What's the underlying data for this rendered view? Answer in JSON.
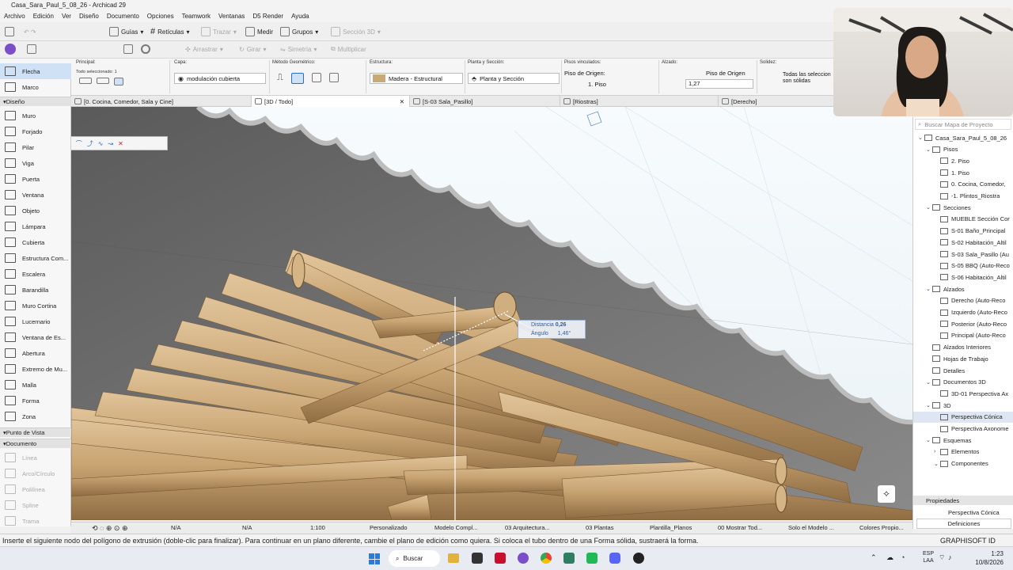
{
  "window": {
    "title": "Casa_Sara_Paul_5_08_26 - Archicad 29"
  },
  "menu": [
    "Archivo",
    "Edición",
    "Ver",
    "Diseño",
    "Documento",
    "Opciones",
    "Teamwork",
    "Ventanas",
    "D5 Render",
    "Ayuda"
  ],
  "toolbar1": {
    "guias": "Guías",
    "reticulas": "Retículas",
    "trazar": "Trazar",
    "medir": "Medir",
    "grupos": "Grupos",
    "seccion3d": "Sección 3D"
  },
  "toolbar2": {
    "arrastrar": "Arrastrar",
    "girar": "Girar",
    "simetria": "Simetría",
    "multiplicar": "Multiplicar"
  },
  "infobox": {
    "principal_label": "Principal:",
    "todo_sel": "Todo seleccionado: 1",
    "capa_label": "Capa:",
    "capa_value": "modulación cubierta",
    "metodo_label": "Método Geométrico:",
    "estructura_label": "Estructura:",
    "estructura_value": "Madera - Estructural",
    "planta_label": "Planta y Sección:",
    "planta_value": "Planta y Sección",
    "pisos_label": "Pisos vinculados:",
    "piso_origen_label": "Piso de Origen:",
    "piso_origen_value": "1. Piso",
    "alzado_label": "Alzado:",
    "alzado_ref": "Piso de Origen",
    "alzado_value": "1,27",
    "solidez_label": "Solidez:",
    "solidez_value": "Todas las seleccion son sólidas"
  },
  "toolbox": {
    "tools": [
      "Flecha",
      "Marco"
    ],
    "diseno": "Diseño",
    "design_tools": [
      "Muro",
      "Forjado",
      "Pilar",
      "Viga",
      "Puerta",
      "Ventana",
      "Objeto",
      "Lámpara",
      "Cubierta",
      "Estructura Com...",
      "Escalera",
      "Barandilla",
      "Muro Cortina",
      "Lucernario",
      "Ventana de Es...",
      "Abertura",
      "Extremo de Mu...",
      "Malla",
      "Forma",
      "Zona"
    ],
    "punto_vista": "Punto de Vista",
    "documento": "Documento",
    "doc_tools": [
      "Línea",
      "Arco/Círculo",
      "Polilínea",
      "Spline",
      "Trama"
    ]
  },
  "tabs": [
    "[0. Cocina, Comedor, Sala y Cine]",
    "[3D / Todo]",
    "[S-03 Sala_Pasillo]",
    "[Riostras]",
    "[Derecho]"
  ],
  "tooltip": {
    "dist_label": "Distancia",
    "dist_value": "0,26",
    "ang_label": "Ángulo",
    "ang_value": "1,46°"
  },
  "navigator": {
    "search": "Buscar Mapa de Proyecto",
    "items": [
      {
        "t": "Casa_Sara_Paul_5_08_26",
        "l": 0,
        "a": "v"
      },
      {
        "t": "Pisos",
        "l": 1,
        "a": "v"
      },
      {
        "t": "2. Piso",
        "l": 2,
        "a": ""
      },
      {
        "t": "1. Piso",
        "l": 2,
        "a": ""
      },
      {
        "t": "0. Cocina, Comedor,",
        "l": 2,
        "a": ""
      },
      {
        "t": "-1. Plintos_Riostra",
        "l": 2,
        "a": ""
      },
      {
        "t": "Secciones",
        "l": 1,
        "a": "v"
      },
      {
        "t": "MUEBLE Sección Cor",
        "l": 2,
        "a": ""
      },
      {
        "t": "S-01 Baño_Principal",
        "l": 2,
        "a": ""
      },
      {
        "t": "S-02 Habitación_Altil",
        "l": 2,
        "a": ""
      },
      {
        "t": "S-03 Sala_Pasillo (Au",
        "l": 2,
        "a": ""
      },
      {
        "t": "S-05 BBQ (Auto-Reco",
        "l": 2,
        "a": ""
      },
      {
        "t": "S-06 Habitación_Altil",
        "l": 2,
        "a": ""
      },
      {
        "t": "Alzados",
        "l": 1,
        "a": "v"
      },
      {
        "t": "Derecho (Auto-Reco",
        "l": 2,
        "a": ""
      },
      {
        "t": "Izquierdo (Auto-Reco",
        "l": 2,
        "a": ""
      },
      {
        "t": "Posterior (Auto-Reco",
        "l": 2,
        "a": ""
      },
      {
        "t": "Principal (Auto-Reco",
        "l": 2,
        "a": ""
      },
      {
        "t": "Alzados Interiores",
        "l": 1,
        "a": ""
      },
      {
        "t": "Hojas de Trabajo",
        "l": 1,
        "a": ""
      },
      {
        "t": "Detalles",
        "l": 1,
        "a": ""
      },
      {
        "t": "Documentos 3D",
        "l": 1,
        "a": "v"
      },
      {
        "t": "3D-01 Perspectiva Ax",
        "l": 2,
        "a": ""
      },
      {
        "t": "3D",
        "l": 1,
        "a": "v"
      },
      {
        "t": "Perspectiva Cónica",
        "l": 2,
        "a": "",
        "sel": true
      },
      {
        "t": "Perspectiva Axonome",
        "l": 2,
        "a": ""
      },
      {
        "t": "Esquemas",
        "l": 1,
        "a": "v"
      },
      {
        "t": "Elementos",
        "l": 2,
        "a": ">"
      },
      {
        "t": "Componentes",
        "l": 2,
        "a": "v"
      }
    ],
    "propiedades": "Propiedades",
    "prop_value": "Perspectiva Cónica",
    "definiciones": "Definiciones"
  },
  "status": {
    "na1": "N/A",
    "na2": "N/A",
    "scale": "1:100",
    "pen": "Personalizado",
    "model": "Modelo Compl...",
    "arch": "03 Arquitectura...",
    "plantas": "03 Plantas",
    "plantilla": "Plantilla_Planos",
    "mostrar": "00 Mostrar Tod...",
    "solo": "Solo el Modelo ...",
    "colores": "Colores Propio..."
  },
  "prompt": "Inserte el siguiente nodo del polígono de extrusión (doble-clic para finalizar). Para continuar en un plano diferente, cambie el plano de edición como quiera. Si coloca el tubo dentro de una Forma sólida, sustraerá la forma.",
  "graphisoft": "GRAPHISOFT ID",
  "taskbar": {
    "search": "Buscar",
    "lang1": "ESP",
    "lang2": "LAA",
    "time": "1:23",
    "date": "10/8/2026"
  },
  "right_cut": "dera"
}
